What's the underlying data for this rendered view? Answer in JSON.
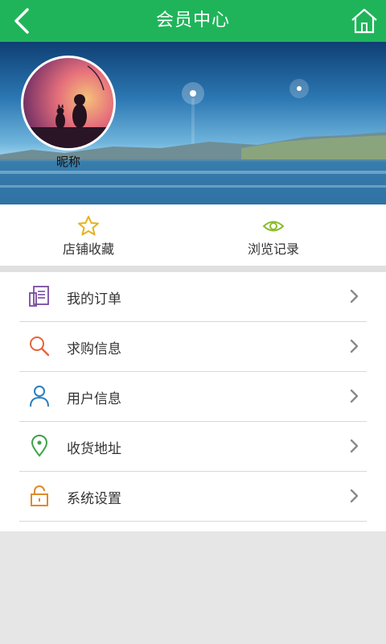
{
  "header": {
    "title": "会员中心",
    "back_icon": "chevron-left-icon",
    "home_icon": "home-icon",
    "color": "#1fb45a"
  },
  "profile": {
    "nickname": "昵称"
  },
  "quick_actions": [
    {
      "label": "店铺收藏",
      "icon": "star-icon",
      "color": "#e6b21e"
    },
    {
      "label": "浏览记录",
      "icon": "eye-icon",
      "color": "#8cbc2f"
    }
  ],
  "menu": [
    {
      "label": "我的订单",
      "icon": "orders-icon",
      "color": "#7a4aa0"
    },
    {
      "label": "求购信息",
      "icon": "search-icon",
      "color": "#e8643c"
    },
    {
      "label": "用户信息",
      "icon": "user-icon",
      "color": "#2a7fc0"
    },
    {
      "label": "收货地址",
      "icon": "location-pin-icon",
      "color": "#3ea24a"
    },
    {
      "label": "系统设置",
      "icon": "lock-icon",
      "color": "#e08a2a"
    }
  ]
}
